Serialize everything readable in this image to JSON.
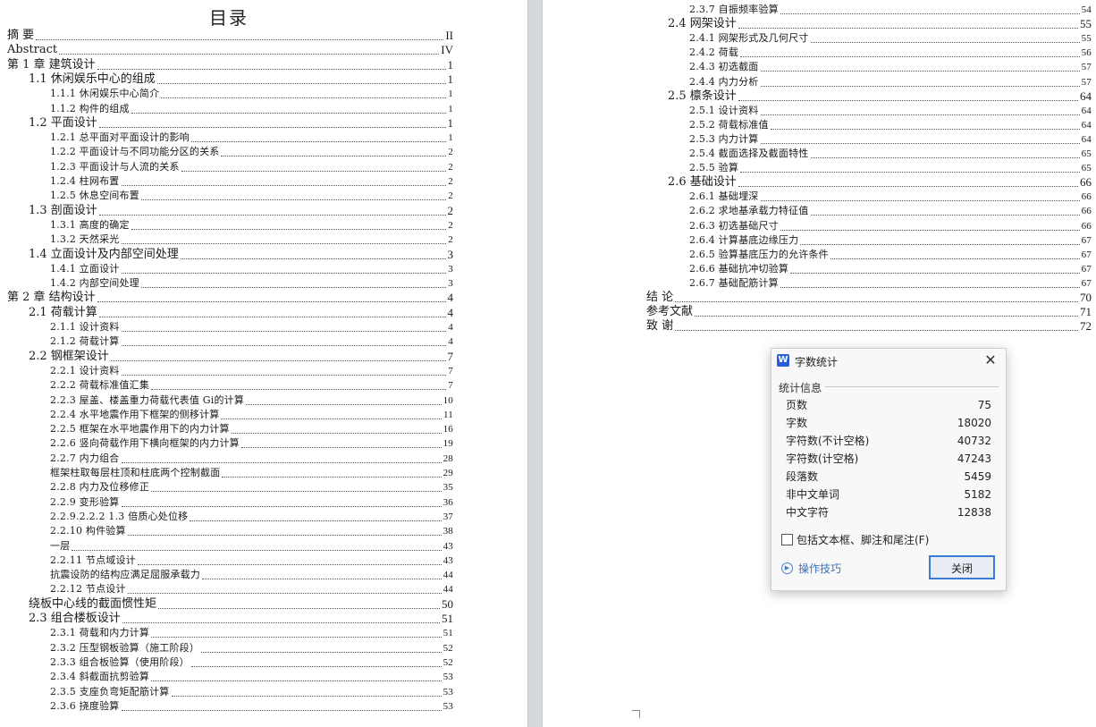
{
  "left_page": {
    "title": "目录",
    "entries": [
      {
        "t": "摘  要",
        "p": "II",
        "lv": 1
      },
      {
        "t": "Abstract",
        "p": "IV",
        "lv": 1
      },
      {
        "t": "第 1 章  建筑设计",
        "p": "1",
        "lv": 1
      },
      {
        "t": "1.1 休闲娱乐中心的组成",
        "p": "1",
        "lv": 2
      },
      {
        "t": "1.1.1  休闲娱乐中心简介",
        "p": "1",
        "lv": 3
      },
      {
        "t": "1.1.2  构件的组成",
        "p": "1",
        "lv": 3
      },
      {
        "t": "1.2 平面设计",
        "p": "1",
        "lv": 2
      },
      {
        "t": "1.2.1 总平面对平面设计的影响",
        "p": "1",
        "lv": 3
      },
      {
        "t": "1.2.2 平面设计与不同功能分区的关系",
        "p": "2",
        "lv": 3
      },
      {
        "t": "1.2.3 平面设计与人流的关系",
        "p": "2",
        "lv": 3
      },
      {
        "t": "1.2.4 柱网布置",
        "p": "2",
        "lv": 3
      },
      {
        "t": "1.2.5  休息空间布置",
        "p": "2",
        "lv": 3
      },
      {
        "t": "1.3  剖面设计",
        "p": "2",
        "lv": 2
      },
      {
        "t": "1.3.1 高度的确定",
        "p": "2",
        "lv": 3
      },
      {
        "t": "1.3.2  天然采光",
        "p": "2",
        "lv": 3
      },
      {
        "t": "1.4 立面设计及内部空间处理",
        "p": "3",
        "lv": 2
      },
      {
        "t": "1.4.1  立面设计",
        "p": "3",
        "lv": 3
      },
      {
        "t": "1.4.2  内部空间处理",
        "p": "3",
        "lv": 3
      },
      {
        "t": "第 2 章  结构设计",
        "p": "4",
        "lv": 1
      },
      {
        "t": "2.1  荷载计算",
        "p": "4",
        "lv": 2
      },
      {
        "t": "2.1.1  设计资料",
        "p": "4",
        "lv": 3
      },
      {
        "t": "2.1.2  荷载计算",
        "p": "4",
        "lv": 3
      },
      {
        "t": "2.2  钢框架设计",
        "p": "7",
        "lv": 2
      },
      {
        "t": "2.2.1  设计资料",
        "p": "7",
        "lv": 3
      },
      {
        "t": "2.2.2  荷载标准值汇集",
        "p": "7",
        "lv": 3
      },
      {
        "t": "2.2.3  屋盖、楼盖重力荷载代表值 Gi的计算",
        "p": "10",
        "lv": 3
      },
      {
        "t": "2.2.4  水平地震作用下框架的侧移计算",
        "p": "11",
        "lv": 3
      },
      {
        "t": "2.2.5  框架在水平地震作用下的内力计算",
        "p": "16",
        "lv": 3
      },
      {
        "t": "2.2.6  竖向荷载作用下横向框架的内力计算",
        "p": "19",
        "lv": 3
      },
      {
        "t": "2.2.7  内力组合",
        "p": "28",
        "lv": 3
      },
      {
        "t": "框架柱取每层柱顶和柱底两个控制截面",
        "p": "29",
        "lv": 3
      },
      {
        "t": "2.2.8  内力及位移修正",
        "p": "35",
        "lv": 3
      },
      {
        "t": "2.2.9  变形验算",
        "p": "36",
        "lv": 3
      },
      {
        "t": "2.2.9.2.2.2 1.3 倍质心处位移",
        "p": "37",
        "lv": 3
      },
      {
        "t": "2.2.10  构件验算",
        "p": "38",
        "lv": 3
      },
      {
        "t": "一层",
        "p": "43",
        "lv": 3
      },
      {
        "t": "2.2.11  节点域设计",
        "p": "43",
        "lv": 3
      },
      {
        "t": "抗震设防的结构应满足屈服承载力",
        "p": "44",
        "lv": 3
      },
      {
        "t": "2.2.12  节点设计",
        "p": "44",
        "lv": 3
      },
      {
        "t": "绕板中心线的截面惯性矩",
        "p": "50",
        "lv": 2
      },
      {
        "t": "2.3  组合楼板设计",
        "p": "51",
        "lv": 2
      },
      {
        "t": "2.3.1  荷载和内力计算",
        "p": "51",
        "lv": 3
      },
      {
        "t": "2.3.2  压型钢板验算（施工阶段）",
        "p": "52",
        "lv": 3
      },
      {
        "t": "2.3.3  组合板验算（使用阶段）",
        "p": "52",
        "lv": 3
      },
      {
        "t": "2.3.4  斜截面抗剪验算",
        "p": "53",
        "lv": 3
      },
      {
        "t": "2.3.5  支座负弯矩配筋计算",
        "p": "53",
        "lv": 3
      },
      {
        "t": "2.3.6  挠度验算",
        "p": "53",
        "lv": 3
      }
    ]
  },
  "right_page": {
    "entries": [
      {
        "t": "2.3.7  自振频率验算",
        "p": "54",
        "lv": 3
      },
      {
        "t": "2.4  网架设计",
        "p": "55",
        "lv": 2
      },
      {
        "t": "2.4.1  网架形式及几何尺寸",
        "p": "55",
        "lv": 3
      },
      {
        "t": "2.4.2  荷载",
        "p": "56",
        "lv": 3
      },
      {
        "t": "2.4.3  初选截面",
        "p": "57",
        "lv": 3
      },
      {
        "t": "2.4.4  内力分析",
        "p": "57",
        "lv": 3
      },
      {
        "t": "2.5  檩条设计",
        "p": "64",
        "lv": 2
      },
      {
        "t": "2.5.1      设计资料",
        "p": "64",
        "lv": 3
      },
      {
        "t": "2.5.2      荷载标准值",
        "p": "64",
        "lv": 3
      },
      {
        "t": "2.5.3      内力计算",
        "p": "64",
        "lv": 3
      },
      {
        "t": "2.5.4      截面选择及截面特性",
        "p": "65",
        "lv": 3
      },
      {
        "t": "2.5.5      验算",
        "p": "65",
        "lv": 3
      },
      {
        "t": "2.6  基础设计",
        "p": "66",
        "lv": 2
      },
      {
        "t": "2.6.1  基础埋深",
        "p": "66",
        "lv": 3
      },
      {
        "t": "2.6.2  求地基承载力特征值",
        "p": "66",
        "lv": 3
      },
      {
        "t": "2.6.3  初选基础尺寸",
        "p": "66",
        "lv": 3
      },
      {
        "t": "2.6.4 计算基底边缘压力",
        "p": "67",
        "lv": 3
      },
      {
        "t": "2.6.5  验算基底压力的允许条件",
        "p": "67",
        "lv": 3
      },
      {
        "t": "2.6.6  基础抗冲切验算",
        "p": "67",
        "lv": 3
      },
      {
        "t": "2.6.7  基础配筋计算",
        "p": "67",
        "lv": 3
      },
      {
        "t": "结  论",
        "p": "70",
        "lv": 1
      },
      {
        "t": "参考文献",
        "p": "71",
        "lv": 1
      },
      {
        "t": "致  谢",
        "p": "72",
        "lv": 1
      }
    ]
  },
  "dialog": {
    "app_icon": "W",
    "title": "字数统计",
    "close_glyph": "✕",
    "section": "统计信息",
    "stats": [
      {
        "label": "页数",
        "value": "75"
      },
      {
        "label": "字数",
        "value": "18020"
      },
      {
        "label": "字符数(不计空格)",
        "value": "40732"
      },
      {
        "label": "字符数(计空格)",
        "value": "47243"
      },
      {
        "label": "段落数",
        "value": "5459"
      },
      {
        "label": "非中文单词",
        "value": "5182"
      },
      {
        "label": "中文字符",
        "value": "12838"
      }
    ],
    "checkbox_label": "包括文本框、脚注和尾注(F)",
    "checkbox_checked": false,
    "help_link": "操作技巧",
    "close_button": "关闭",
    "icons": {
      "app": "wps-writer-icon",
      "help": "play-circle-icon",
      "close": "close-icon"
    },
    "colors": {
      "accent": "#3a7bd5",
      "link": "#3c72c0",
      "app_icon_bg": "#2b5fd9"
    }
  }
}
